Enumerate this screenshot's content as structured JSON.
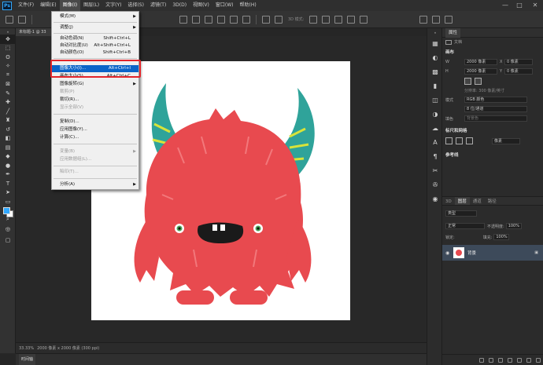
{
  "menubar": {
    "logo": "Ps",
    "items": [
      "文件(F)",
      "编辑(E)",
      "图像(I)",
      "图层(L)",
      "文字(Y)",
      "选择(S)",
      "滤镜(T)",
      "3D(D)",
      "视图(V)",
      "窗口(W)",
      "帮助(H)"
    ],
    "window_controls": [
      "—",
      "□",
      "✕"
    ]
  },
  "optionsbar": {
    "mode_label": "3D 模式:"
  },
  "document": {
    "tab_title": "未标题-1 @ 33",
    "zoom": "33.33%",
    "size_info": "2000 像素 x 2000 像素 (300 ppi)"
  },
  "timeline": {
    "tab_label": "时间轴"
  },
  "image_menu": {
    "items": [
      {
        "label": "模式(M)",
        "shortcut": "",
        "submenu": true,
        "disabled": false,
        "highlighted": false
      },
      {
        "label": "调整(J)",
        "shortcut": "",
        "submenu": true,
        "disabled": false,
        "highlighted": false
      },
      {
        "label": "自动色调(N)",
        "shortcut": "Shift+Ctrl+L",
        "submenu": false,
        "disabled": false,
        "highlighted": false
      },
      {
        "label": "自动对比度(U)",
        "shortcut": "Alt+Shift+Ctrl+L",
        "submenu": false,
        "disabled": false,
        "highlighted": false
      },
      {
        "label": "自动颜色(O)",
        "shortcut": "Shift+Ctrl+B",
        "submenu": false,
        "disabled": false,
        "highlighted": false
      },
      {
        "label": "图像大小(I)...",
        "shortcut": "Alt+Ctrl+I",
        "submenu": false,
        "disabled": false,
        "highlighted": true
      },
      {
        "label": "画布大小(S)...",
        "shortcut": "Alt+Ctrl+C",
        "submenu": false,
        "disabled": false,
        "highlighted": false
      },
      {
        "label": "图像旋转(G)",
        "shortcut": "",
        "submenu": true,
        "disabled": false,
        "highlighted": false
      },
      {
        "label": "裁剪(P)",
        "shortcut": "",
        "submenu": false,
        "disabled": true,
        "highlighted": false
      },
      {
        "label": "裁切(R)...",
        "shortcut": "",
        "submenu": false,
        "disabled": false,
        "highlighted": false
      },
      {
        "label": "显示全部(V)",
        "shortcut": "",
        "submenu": false,
        "disabled": true,
        "highlighted": false
      },
      {
        "label": "复制(D)...",
        "shortcut": "",
        "submenu": false,
        "disabled": false,
        "highlighted": false
      },
      {
        "label": "应用图像(Y)...",
        "shortcut": "",
        "submenu": false,
        "disabled": false,
        "highlighted": false
      },
      {
        "label": "计算(C)...",
        "shortcut": "",
        "submenu": false,
        "disabled": false,
        "highlighted": false
      },
      {
        "label": "变量(B)",
        "shortcut": "",
        "submenu": true,
        "disabled": true,
        "highlighted": false
      },
      {
        "label": "应用数据组(L)...",
        "shortcut": "",
        "submenu": false,
        "disabled": true,
        "highlighted": false
      },
      {
        "label": "陷印(T)...",
        "shortcut": "",
        "submenu": false,
        "disabled": true,
        "highlighted": false
      },
      {
        "label": "分析(A)",
        "shortcut": "",
        "submenu": true,
        "disabled": false,
        "highlighted": false
      }
    ]
  },
  "properties": {
    "title": "属性",
    "doc_label": "文档",
    "canvas_section": "画布",
    "width_label": "W",
    "width_value": "2000 像素",
    "height_label": "H",
    "height_value": "2000 像素",
    "x_label": "X",
    "x_value": "0 像素",
    "y_label": "Y",
    "y_value": "0 像素",
    "resolution": "分辨率: 300 像素/英寸",
    "mode_label": "模式",
    "mode_value": "RGB 颜色",
    "depth_value": "8 位/通道",
    "fill_label": "填色",
    "fill_value": "背景色",
    "rulers_section": "标尺和网格",
    "ruler_unit": "像素",
    "guides_section": "参考线"
  },
  "layers": {
    "tabs": [
      "3D",
      "图层",
      "通道",
      "路径"
    ],
    "filter_kind": "类型",
    "blend_mode": "正常",
    "opacity_label": "不透明度:",
    "opacity_value": "100%",
    "lock_label": "锁定:",
    "fill_label": "填充:",
    "fill_value": "100%",
    "layer_name": "背景"
  },
  "colors": {
    "accent": "#31a8ff",
    "menu_highlight": "#0b64c8",
    "callout": "#e3252b",
    "monster": "#e84a4f",
    "horn": "#2fa39a"
  },
  "icons": [
    "move-icon",
    "marquee-icon",
    "lasso-icon",
    "magic-wand-icon",
    "crop-icon",
    "eyedropper-icon",
    "healing-brush-icon",
    "brush-icon",
    "stamp-icon",
    "history-brush-icon",
    "eraser-icon",
    "gradient-icon",
    "blur-icon",
    "dodge-icon",
    "pen-icon",
    "type-icon",
    "path-selection-icon",
    "rectangle-icon",
    "hand-icon",
    "zoom-icon",
    "edit-toolbar-icon"
  ]
}
